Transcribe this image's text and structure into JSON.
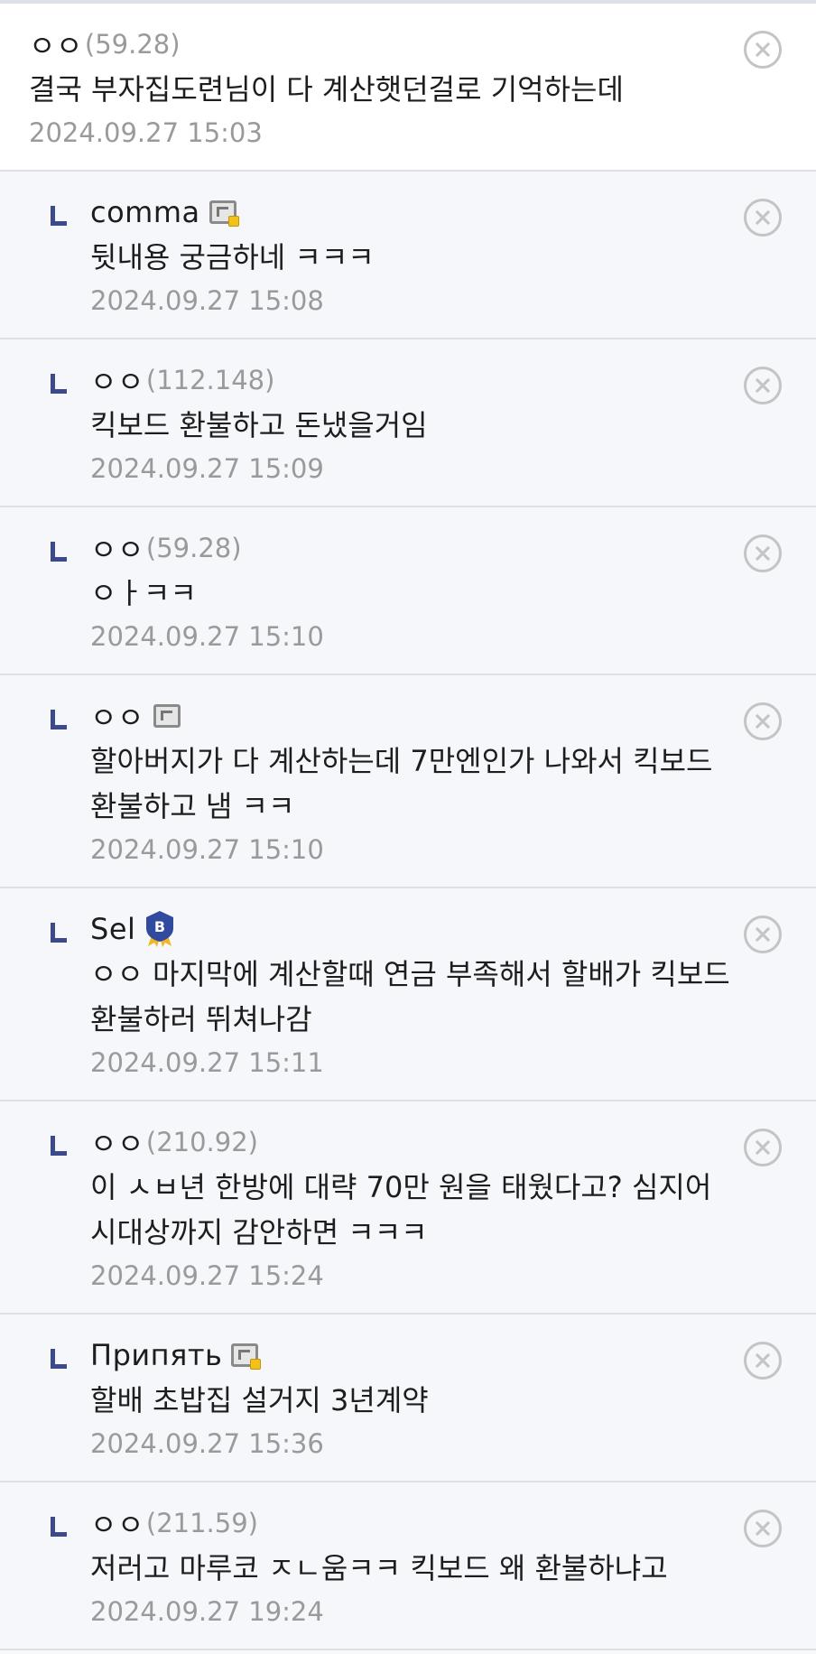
{
  "comments": [
    {
      "nick": "ㅇㅇ",
      "ip": "(59.28)",
      "text": "결국 부자집도련님이 다 계산햇던걸로 기억하는데",
      "date": "2024.09.27 15:03"
    },
    {
      "nick": "comma",
      "ip": "",
      "text": "뒷내용 궁금하네 ㅋㅋㅋ",
      "date": "2024.09.27 15:08"
    },
    {
      "nick": "ㅇㅇ",
      "ip": "(112.148)",
      "text": "킥보드 환불하고 돈냈을거임",
      "date": "2024.09.27 15:09"
    },
    {
      "nick": "ㅇㅇ",
      "ip": "(59.28)",
      "text": "ㅇㅏㅋㅋ",
      "date": "2024.09.27 15:10"
    },
    {
      "nick": "ㅇㅇ",
      "ip": "",
      "text": "할아버지가 다 계산하는데 7만엔인가 나와서 킥보드 환불하고 냄 ㅋㅋ",
      "date": "2024.09.27 15:10"
    },
    {
      "nick": "Sel",
      "ip": "",
      "text": "ㅇㅇ 마지막에 계산할때 연금 부족해서 할배가 킥보드 환불하러 뛰쳐나감",
      "date": "2024.09.27 15:11"
    },
    {
      "nick": "ㅇㅇ",
      "ip": "(210.92)",
      "text": "이 ㅅㅂ년 한방에 대략 70만 원을 태웠다고? 심지어 시대상까지 감안하면 ㅋㅋㅋ",
      "date": "2024.09.27 15:24"
    },
    {
      "nick": "Припять",
      "ip": "",
      "text": "할배 초밥집 설거지 3년계약",
      "date": "2024.09.27 15:36"
    },
    {
      "nick": "ㅇㅇ",
      "ip": "(211.59)",
      "text": "저러고 마루코 ㅈㄴ움ㅋㅋ 킥보드 왜 환불하냐고",
      "date": "2024.09.27 19:24"
    }
  ],
  "badge_icons": [
    "",
    "gallery-member-icon",
    "",
    "",
    "gallery-member-icon",
    "best-shield-icon",
    "",
    "gallery-member-icon",
    ""
  ],
  "shield_letter": "B",
  "colors": {
    "reply_mark": "#3c4a8c",
    "meta": "#9a9a9a",
    "shield": "#2f4a9e",
    "ribbon": "#f0b623"
  }
}
